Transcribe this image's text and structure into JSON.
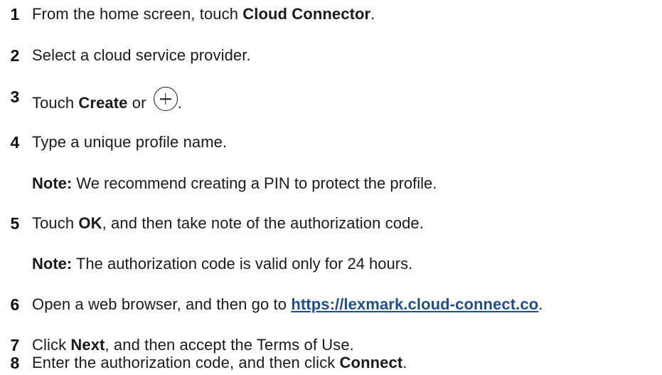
{
  "steps": [
    {
      "num": "1",
      "pre": "From the home screen, touch ",
      "bold": "Cloud Connector",
      "post": "."
    },
    {
      "num": "2",
      "text": "Select a cloud service provider."
    },
    {
      "num": "3",
      "pre": "Touch ",
      "bold": "Create",
      "mid": " or ",
      "post": "."
    },
    {
      "num": "4",
      "text": "Type a unique profile name."
    },
    {
      "note_label": "Note:",
      "note_text": " We recommend creating a PIN to protect the profile."
    },
    {
      "num": "5",
      "pre": "Touch ",
      "bold": "OK",
      "post": ", and then take note of the authorization code."
    },
    {
      "note_label": "Note:",
      "note_text": " The authorization code is valid only for 24 hours."
    },
    {
      "num": "6",
      "pre": "Open a web browser, and then go to ",
      "link": "https://lexmark.cloud-connect.co",
      "post": "."
    },
    {
      "num": "7",
      "pre": "Click ",
      "bold": "Next",
      "post": ", and then accept the Terms of Use."
    },
    {
      "num": "8",
      "pre": "Enter the authorization code, and then click ",
      "bold": "Connect",
      "post": "."
    }
  ],
  "icons": {
    "step3": "plus-circle-icon"
  }
}
